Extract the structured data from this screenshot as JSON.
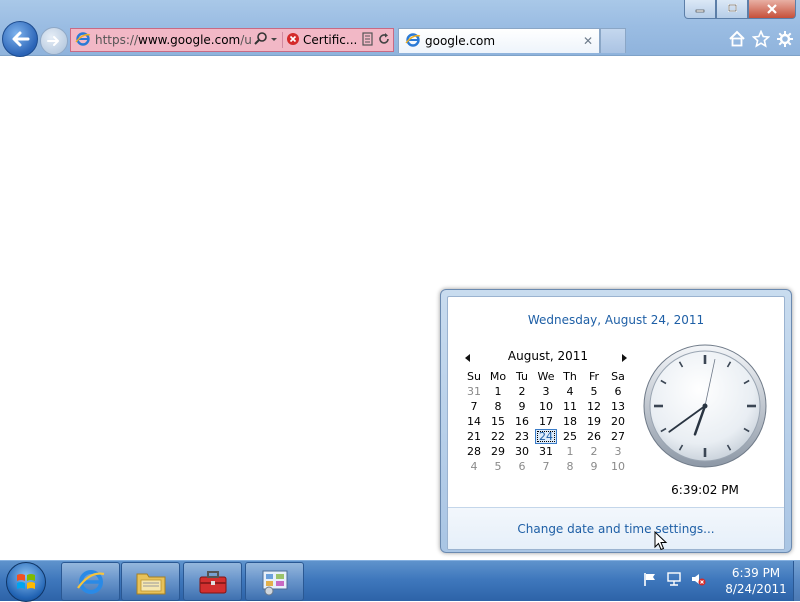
{
  "browser": {
    "address": {
      "url_proto": "https://",
      "url_host": "www.google.com",
      "url_rest": "/url?",
      "certificate_label": "Certific..."
    },
    "tab": {
      "title": "google.com"
    },
    "icons": [
      "back-arrow-icon",
      "forward-arrow-icon",
      "ie-logo-icon",
      "search-icon",
      "certificate-error-icon",
      "compatibility-icon",
      "refresh-icon",
      "home-icon",
      "favorites-star-icon",
      "gear-icon"
    ]
  },
  "flyout": {
    "full_date": "Wednesday, August 24, 2011",
    "month_label": "August, 2011",
    "weekdays": [
      "Su",
      "Mo",
      "Tu",
      "We",
      "Th",
      "Fr",
      "Sa"
    ],
    "weeks": [
      [
        "31",
        "1",
        "2",
        "3",
        "4",
        "5",
        "6"
      ],
      [
        "7",
        "8",
        "9",
        "10",
        "11",
        "12",
        "13"
      ],
      [
        "14",
        "15",
        "16",
        "17",
        "18",
        "19",
        "20"
      ],
      [
        "21",
        "22",
        "23",
        "24",
        "25",
        "26",
        "27"
      ],
      [
        "28",
        "29",
        "30",
        "31",
        "1",
        "2",
        "3"
      ],
      [
        "4",
        "5",
        "6",
        "7",
        "8",
        "9",
        "10"
      ]
    ],
    "time": "6:39:02 PM",
    "settings_link": "Change date and time settings..."
  },
  "taskbar": {
    "time": "6:39 PM",
    "date": "8/24/2011",
    "apps": [
      "internet-explorer",
      "windows-explorer",
      "toolbox",
      "control-panel"
    ]
  },
  "colors": {
    "link_blue": "#1e5fa6",
    "cert_error_pink": "#f2b8c6",
    "taskbar_blue": "#3f78bd"
  }
}
